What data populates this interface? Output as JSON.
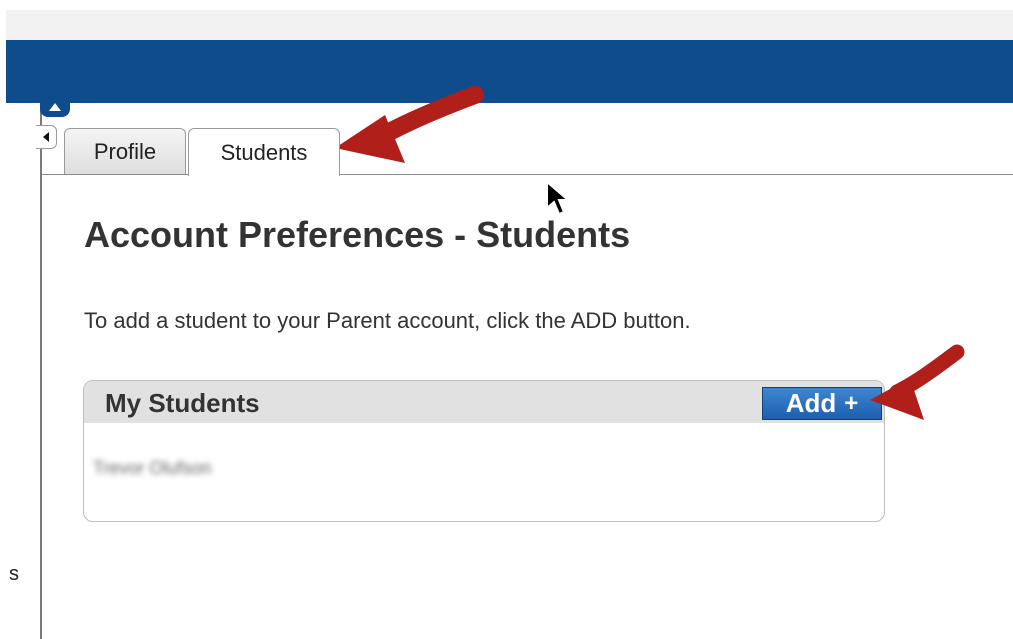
{
  "header": {
    "brand_color": "#0f4c8c"
  },
  "sidebar": {
    "fragment_text": "s"
  },
  "tabs": [
    {
      "label": "Profile",
      "active": false
    },
    {
      "label": "Students",
      "active": true
    }
  ],
  "main": {
    "title": "Account Preferences - Students",
    "instruction": "To add a student to your Parent account, click the ADD button.",
    "panel": {
      "title": "My Students",
      "add_button_label": "Add",
      "add_button_icon": "+",
      "students": [
        "Trevor Olufson"
      ]
    }
  },
  "icons": {
    "collapse_up": "up-arrow-icon",
    "collapse_left": "left-arrow-icon",
    "add": "plus-icon",
    "cursor": "mouse-pointer-icon",
    "annotation": "red-arrow-icon"
  },
  "colors": {
    "arrow_red": "#b11f1a",
    "button_blue": "#2f74bf"
  }
}
